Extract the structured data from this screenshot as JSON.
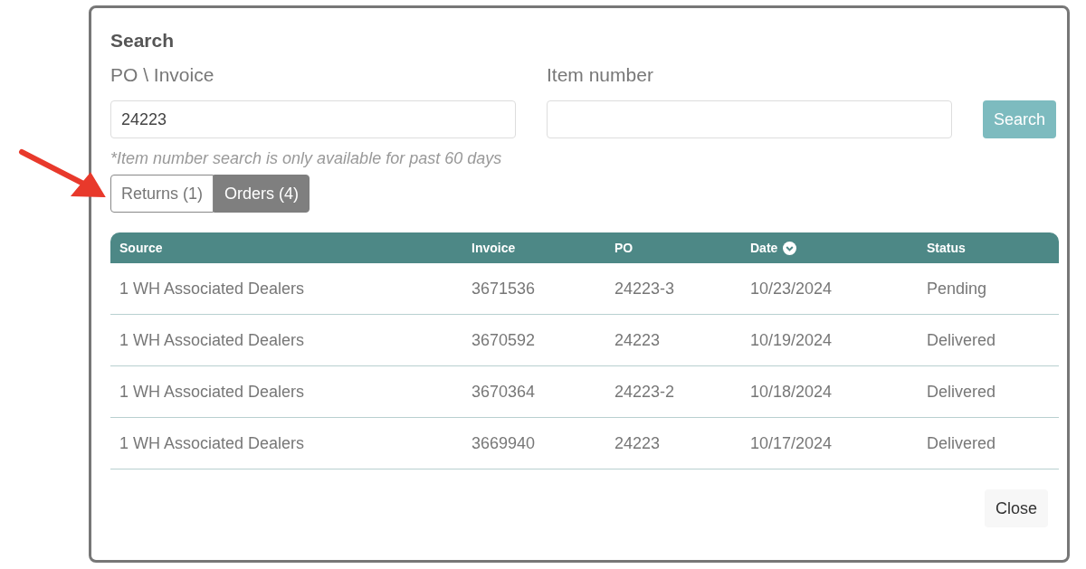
{
  "dialog": {
    "title": "Search",
    "fields": [
      {
        "label": "PO \\ Invoice",
        "value": "24223"
      },
      {
        "label": "Item number"
      }
    ],
    "search_button": "Search",
    "note": "*Item number search is only available for past 60 days",
    "tabs": [
      {
        "label": "Returns (1)",
        "selected": false
      },
      {
        "label": "Orders (4)",
        "selected": true
      }
    ],
    "table": {
      "columns": [
        {
          "label": "Source",
          "sorted": false
        },
        {
          "label": "Invoice",
          "sorted": false
        },
        {
          "label": "PO",
          "sorted": false
        },
        {
          "label": "Date",
          "sorted": true
        },
        {
          "label": "Status",
          "sorted": false
        }
      ],
      "rows": [
        [
          "1 WH Associated Dealers",
          "3671536",
          "24223-3",
          "10/23/2024",
          "Pending"
        ],
        [
          "1 WH Associated Dealers",
          "3670592",
          "24223",
          "10/19/2024",
          "Delivered"
        ],
        [
          "1 WH Associated Dealers",
          "3670364",
          "24223-2",
          "10/18/2024",
          "Delivered"
        ],
        [
          "1 WH Associated Dealers",
          "3669940",
          "24223",
          "10/17/2024",
          "Delivered"
        ]
      ]
    },
    "close_button": "Close"
  }
}
